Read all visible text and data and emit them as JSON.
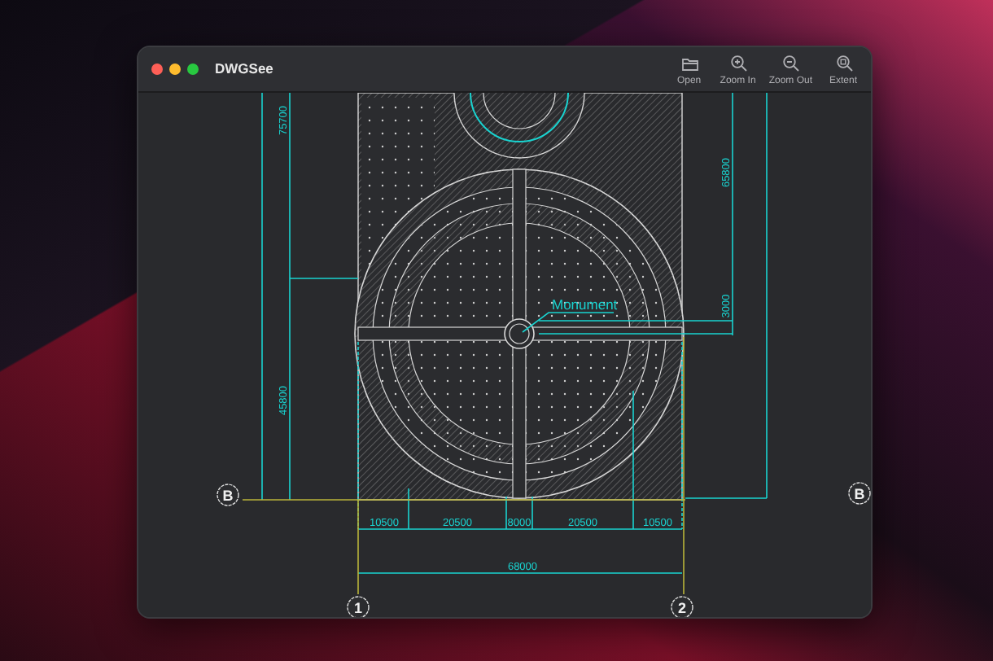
{
  "window": {
    "title": "DWGSee"
  },
  "toolbar": [
    {
      "kind": "open",
      "label": "Open"
    },
    {
      "kind": "zoom_in",
      "label": "Zoom In"
    },
    {
      "kind": "zoom_out",
      "label": "Zoom Out"
    },
    {
      "kind": "extent",
      "label": "Extent"
    }
  ],
  "drawing": {
    "annotation": "Monument",
    "left_dimensions": [
      "75700",
      "45800"
    ],
    "right_dimensions": [
      "65800",
      "3000"
    ],
    "bottom_dimensions": [
      "10500",
      "20500",
      "8000",
      "20500",
      "10500"
    ],
    "overall_dimension": "68000",
    "grid_bubbles": [
      {
        "label": "B"
      },
      {
        "label": "B"
      },
      {
        "label": "1"
      },
      {
        "label": "2"
      }
    ]
  }
}
